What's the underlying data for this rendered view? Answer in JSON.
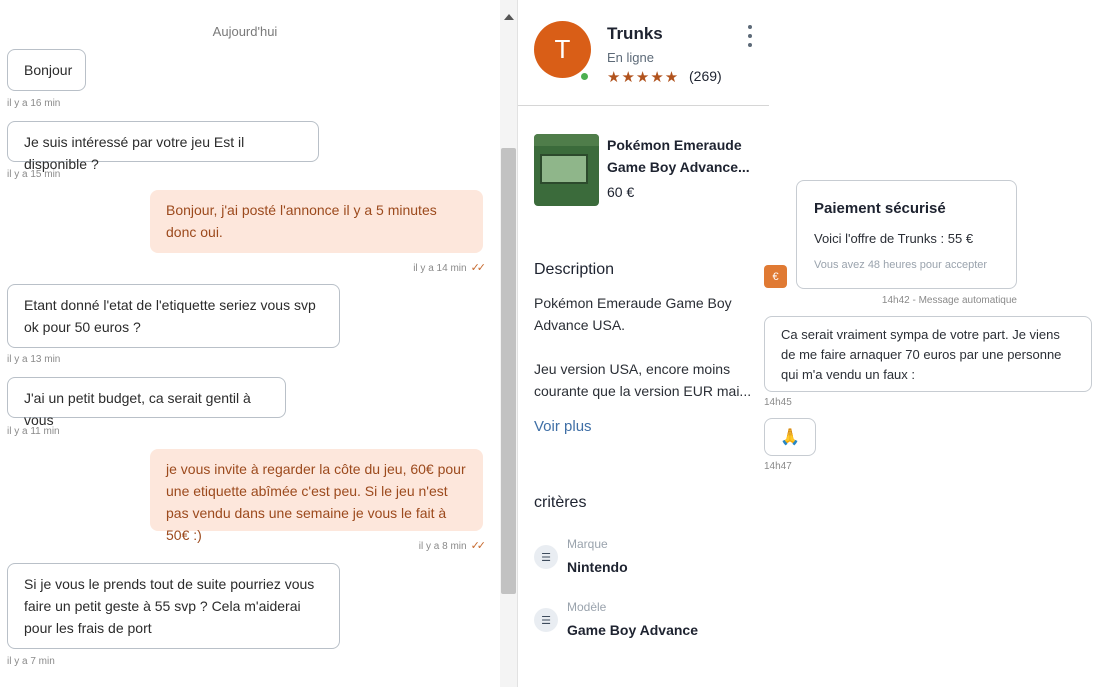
{
  "chat": {
    "day_label": "Aujourd'hui",
    "messages": [
      {
        "text": "Bonjour",
        "meta": "il y a 16 min"
      },
      {
        "text": "Je suis intéressé par votre jeu Est il disponible ?",
        "meta": "il y a 15 min"
      },
      {
        "text": "Bonjour, j'ai posté l'annonce il y a 5 minutes donc oui.",
        "meta": "il y a 14 min"
      },
      {
        "text": "Etant donné l'etat de l'etiquette seriez vous svp ok pour 50 euros ?",
        "meta": "il y a 13 min"
      },
      {
        "text": "J'ai un petit budget, ca serait gentil à vous",
        "meta": "il y a 11 min"
      },
      {
        "text": "je vous invite à regarder la côte du jeu, 60€ pour une etiquette abîmée c'est peu. Si le jeu n'est pas vendu dans une semaine je vous le fait à 50€ :)",
        "meta": "il y a 8 min"
      },
      {
        "text": "Si je vous le prends tout de suite pourriez vous faire un petit geste à 55 svp ? Cela m'aiderai pour les frais de port",
        "meta": "il y a 7 min"
      }
    ]
  },
  "seller": {
    "initial": "T",
    "name": "Trunks",
    "status": "En ligne",
    "stars": "★★★★★",
    "rating_count": "(269)"
  },
  "product": {
    "title": "Pokémon Emeraude Game Boy Advance...",
    "price": "60 €",
    "description_title": "Description",
    "description": "Pokémon Emeraude Game Boy Advance USA.\n\nJeu version USA, encore moins courante que la version EUR mai...",
    "see_more": "Voir plus",
    "criteria_title": "critères",
    "criteria": [
      {
        "label": "Marque",
        "value": "Nintendo"
      },
      {
        "label": "Modèle",
        "value": "Game Boy Advance"
      }
    ]
  },
  "offer": {
    "title": "Paiement sécurisé",
    "text": "Voici l'offre de Trunks : 55 €",
    "note": "Vous avez 48 heures pour accepter",
    "badge": "€",
    "meta": "14h42 - Message automatique"
  },
  "followup": {
    "text": "Ca serait vraiment sympa de votre part. Je viens de me faire arnaquer 70 euros par une personne qui m'a vendu un faux :",
    "time": "14h45",
    "emoji": "🙏",
    "emoji_time": "14h47"
  },
  "colors": {
    "accent": "#d95e17",
    "outgoing_bubble": "#fde7dc",
    "link": "#3f6fa6"
  }
}
